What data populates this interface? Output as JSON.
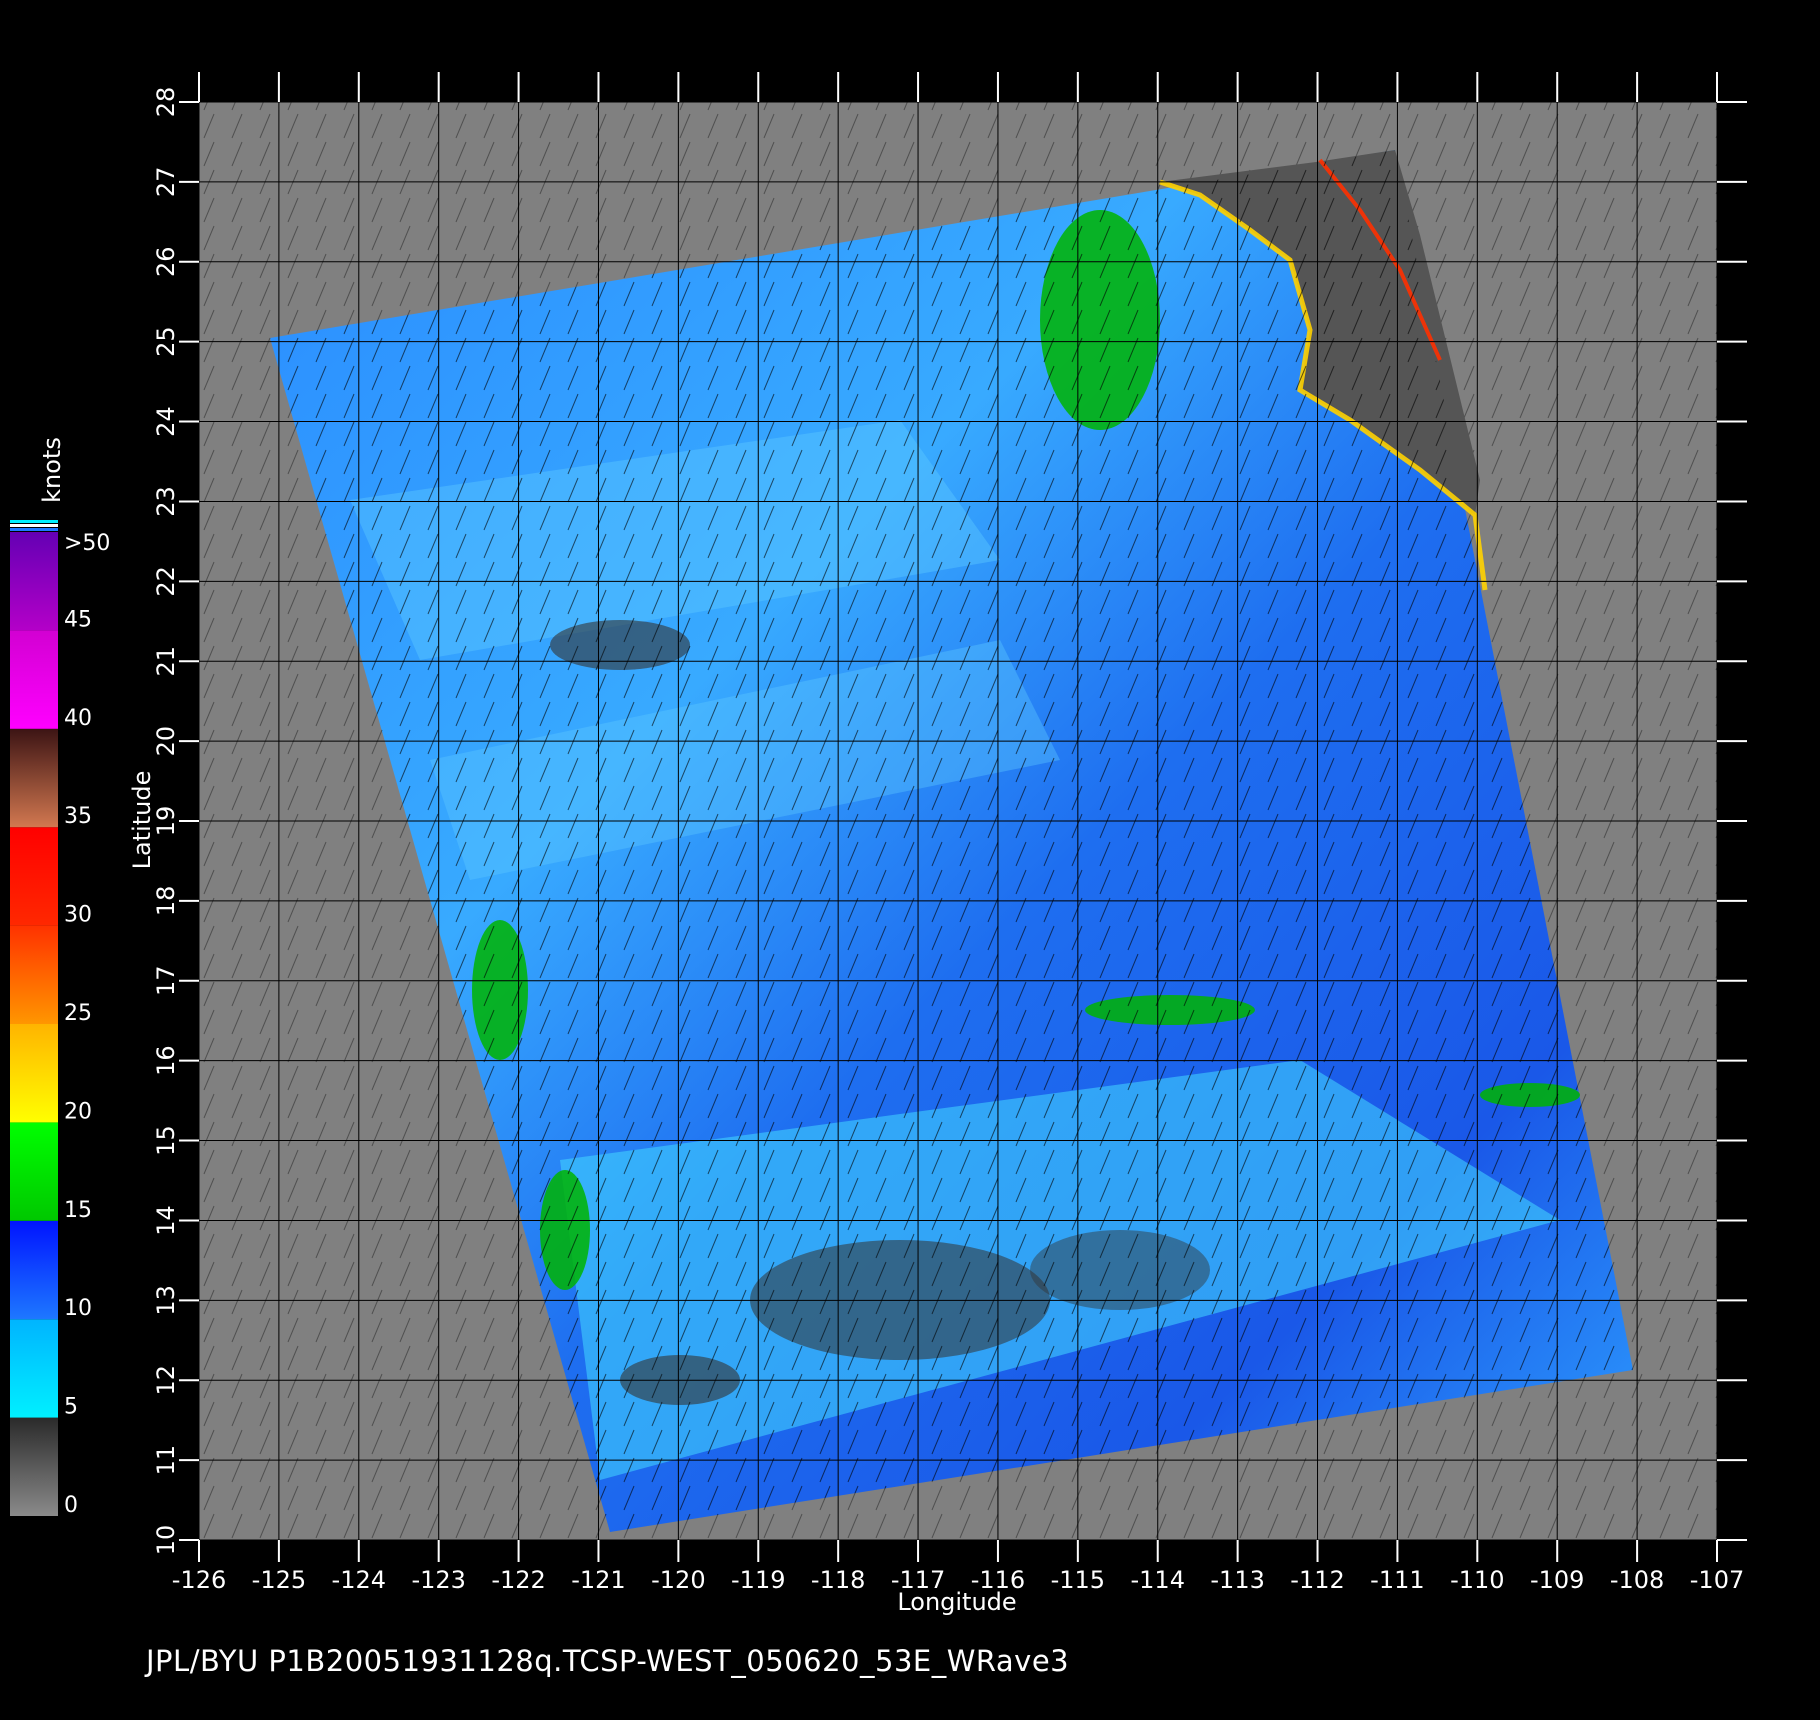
{
  "map": {
    "x_axis": {
      "label": "Longitude",
      "ticks": [
        "-126",
        "-125",
        "-124",
        "-123",
        "-122",
        "-121",
        "-120",
        "-119",
        "-118",
        "-117",
        "-116",
        "-115",
        "-114",
        "-113",
        "-112",
        "-111",
        "-110",
        "-109",
        "-108",
        "-107"
      ]
    },
    "y_axis": {
      "label": "Latitude",
      "ticks": [
        "10",
        "11",
        "12",
        "13",
        "14",
        "15",
        "16",
        "17",
        "18",
        "19",
        "20",
        "21",
        "22",
        "23",
        "24",
        "25",
        "26",
        "27",
        "28"
      ]
    },
    "land_color": "#555555",
    "background_color": "#808080",
    "ocean_color": "#1e78f0",
    "grid_color": "#000000"
  },
  "colorbar": {
    "units": "knots",
    "labels": [
      "0",
      "5",
      "10",
      "15",
      "20",
      "25",
      "30",
      "35",
      "40",
      "45",
      ">50"
    ],
    "bands": [
      {
        "from": 0,
        "to": 5,
        "colors": [
          "#8a8a8a",
          "#2a2a2a"
        ]
      },
      {
        "from": 5,
        "to": 10,
        "colors": [
          "#00f0ff",
          "#00b4ff"
        ]
      },
      {
        "from": 10,
        "to": 15,
        "colors": [
          "#1e78ff",
          "#0014ff"
        ]
      },
      {
        "from": 15,
        "to": 20,
        "colors": [
          "#00c800",
          "#00ff00"
        ]
      },
      {
        "from": 20,
        "to": 25,
        "colors": [
          "#ffff00",
          "#ffb400"
        ]
      },
      {
        "from": 25,
        "to": 30,
        "colors": [
          "#ff9600",
          "#ff3200"
        ]
      },
      {
        "from": 30,
        "to": 35,
        "colors": [
          "#ff2800",
          "#ff0000"
        ]
      },
      {
        "from": 35,
        "to": 40,
        "colors": [
          "#d27850",
          "#3c1414"
        ]
      },
      {
        "from": 40,
        "to": 45,
        "colors": [
          "#ff00ff",
          "#d200d2"
        ]
      },
      {
        "from": 45,
        "to": 50,
        "colors": [
          "#b400c8",
          "#6400b4"
        ]
      }
    ]
  },
  "footer": {
    "text": "JPL/BYU  P1B20051931128q.TCSP-WEST_050620_53E_WRave3"
  }
}
